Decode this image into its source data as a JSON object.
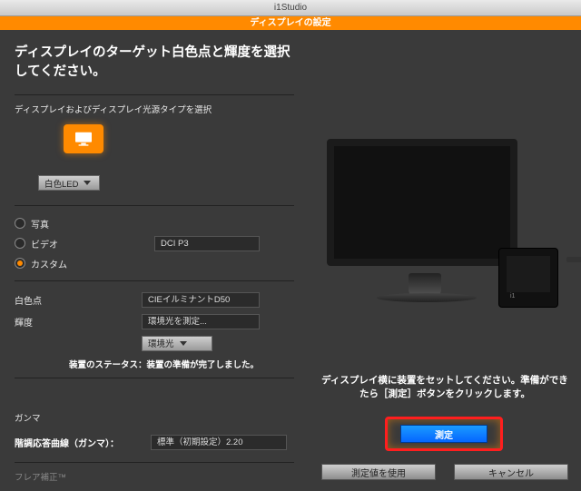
{
  "window": {
    "title": "i1Studio"
  },
  "header": {
    "title": "ディスプレイの設定"
  },
  "left": {
    "heading": "ディスプレイのターゲット白色点と輝度を選択してください。",
    "section_label": "ディスプレイおよびディスプレイ光源タイプを選択",
    "backlight_select": "白色LED",
    "mode": {
      "photo": "写真",
      "video": "ビデオ",
      "custom": "カスタム"
    },
    "video_preset": "DCI P3",
    "whitepoint_label": "白色点",
    "whitepoint_value": "CIEイルミナントD50",
    "luminance_label": "輝度",
    "luminance_value": "環境光を測定...",
    "luminance_select": "環境光",
    "status": "装置のステータス：装置の準備が完了しました。",
    "gamma_label": "ガンマ",
    "tonecurve_label": "階調応答曲線（ガンマ）：",
    "tonecurve_value": "標準（初期設定）2.20",
    "flare_label": "フレア補正™"
  },
  "right": {
    "instruction": "ディスプレイ横に装置をセットしてください。準備ができたら［測定］ボタンをクリックします。",
    "measure_btn": "測定",
    "use_measured_btn": "測定値を使用",
    "cancel_btn": "キャンセル"
  }
}
